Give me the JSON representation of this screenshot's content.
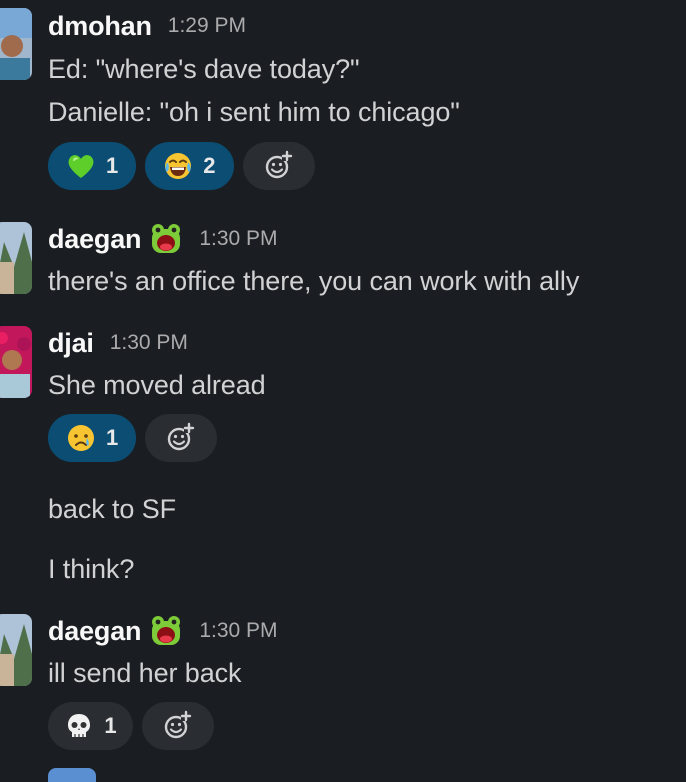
{
  "messages": [
    {
      "user": "dmohan",
      "time": "1:29 PM",
      "lines": [
        "Ed: \"where's dave today?\"",
        "Danielle: \"oh i sent him to chicago\""
      ],
      "reactions": [
        {
          "emoji": "green-heart",
          "count": "1",
          "active": true
        },
        {
          "emoji": "joy",
          "count": "2",
          "active": true
        }
      ]
    },
    {
      "user": "daegan",
      "status_emoji": "frog",
      "time": "1:30 PM",
      "lines": [
        "there's an office there, you can work with ally"
      ]
    },
    {
      "user": "djai",
      "time": "1:30 PM",
      "lines": [
        "She moved alread"
      ],
      "reactions": [
        {
          "emoji": "cry",
          "count": "1",
          "active": true
        }
      ],
      "followups": [
        "back to SF",
        "I think?"
      ]
    },
    {
      "user": "daegan",
      "status_emoji": "frog",
      "time": "1:30 PM",
      "lines": [
        "ill send her back"
      ],
      "reactions": [
        {
          "emoji": "skull",
          "count": "1",
          "active": false
        }
      ]
    }
  ],
  "colors": {
    "background": "#1a1d21",
    "active_reaction": "#0b4d73",
    "inactive_reaction": "#2a2d31"
  }
}
